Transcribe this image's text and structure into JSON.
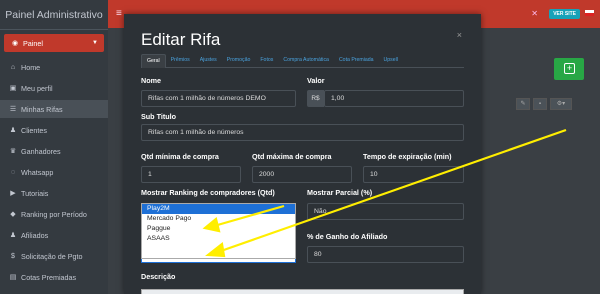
{
  "app": {
    "title": "Painel Administrativo"
  },
  "sidebar": {
    "items": [
      {
        "label": "Painel",
        "icon": "palette-icon",
        "glyph": "◉"
      },
      {
        "label": "Home",
        "icon": "home-icon",
        "glyph": "⌂"
      },
      {
        "label": "Meu perfil",
        "icon": "id-card-icon",
        "glyph": "▣"
      },
      {
        "label": "Minhas Rifas",
        "icon": "list-icon",
        "glyph": "☰"
      },
      {
        "label": "Clientes",
        "icon": "users-icon",
        "glyph": "♟"
      },
      {
        "label": "Ganhadores",
        "icon": "trophy-icon",
        "glyph": "♛"
      },
      {
        "label": "Whatsapp",
        "icon": "whatsapp-icon",
        "glyph": "◌"
      },
      {
        "label": "Tutoriais",
        "icon": "video-icon",
        "glyph": "▶"
      },
      {
        "label": "Ranking por Período",
        "icon": "ranking-icon",
        "glyph": "◆"
      },
      {
        "label": "Afiliados",
        "icon": "affiliates-icon",
        "glyph": "♟"
      },
      {
        "label": "Solicitação de Pgto",
        "icon": "dollar-icon",
        "glyph": "$"
      },
      {
        "label": "Cotas Premiadas",
        "icon": "gift-icon",
        "glyph": "▤"
      }
    ]
  },
  "topbar": {
    "ver_site": "VER SITE",
    "accent": "#c0392b"
  },
  "modal": {
    "title": "Editar Rifa",
    "close": "×",
    "tabs": [
      "Geral",
      "Prêmios",
      "Ajustes",
      "Promoção",
      "Fotos",
      "Compra Automática",
      "Cota Premiada",
      "Upsell"
    ],
    "fields": {
      "nome_label": "Nome",
      "nome_value": "Rifas com 1 milhão de números DEMO",
      "valor_label": "Valor",
      "valor_prefix": "R$",
      "valor_value": "1,00",
      "subtitulo_label": "Sub Titulo",
      "subtitulo_value": "Rifas com 1 milhão de números",
      "qtd_min_label": "Qtd mínima de compra",
      "qtd_min_value": "1",
      "qtd_max_label": "Qtd máxima de compra",
      "qtd_max_value": "2000",
      "tempo_label": "Tempo de expiração (min)",
      "tempo_value": "10",
      "ranking_label": "Mostrar Ranking de compradores (Qtd)",
      "parcial_label": "Mostrar Parcial (%)",
      "parcial_value": "Não",
      "ganho_label": "% de Ganho do Afiliado",
      "ganho_value": "80",
      "gateway_value": "Play2M",
      "descricao_label": "Descrição"
    },
    "dropdown_options": [
      "Play2M",
      "Mercado Pago",
      "Paggue",
      "ASAAS"
    ]
  }
}
